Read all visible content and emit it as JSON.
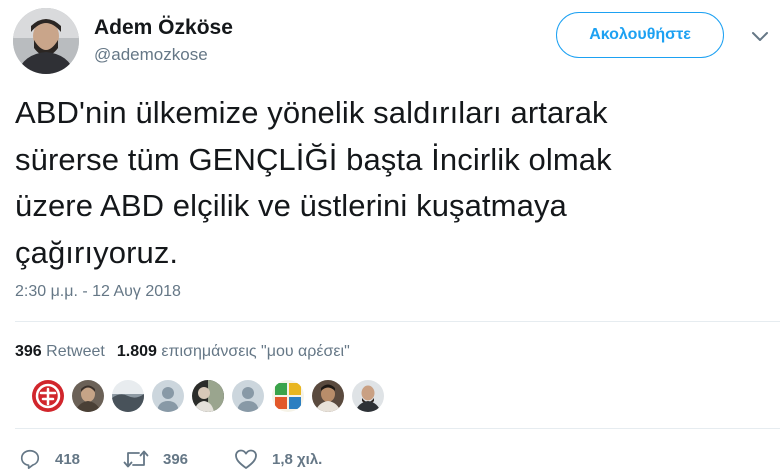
{
  "user": {
    "name": "Adem Özköse",
    "handle": "@ademozkose",
    "follow_label": "Ακολουθήστε"
  },
  "tweet": {
    "lines": [
      "ABD'nin ülkemize yönelik saldırıları artarak",
      "sürerse tüm GENÇLİĞİ başta İncirlik olmak",
      "üzere ABD elçilik ve üstlerini kuşatmaya",
      "çağırıyoruz."
    ],
    "timestamp": "2:30 μ.μ. - 12 Αυγ 2018"
  },
  "stats": {
    "retweets_count": "396",
    "retweets_label": "Retweet",
    "likes_count": "1.809",
    "likes_label": "επισημάνσεις \"μου αρέσει\""
  },
  "likers": [
    {
      "icon": "red-logo-avatar"
    },
    {
      "icon": "person-photo-avatar"
    },
    {
      "icon": "landscape-photo-avatar"
    },
    {
      "icon": "default-avatar"
    },
    {
      "icon": "dark-photo-avatar"
    },
    {
      "icon": "default-avatar"
    },
    {
      "icon": "quba-logo-avatar"
    },
    {
      "icon": "person-photo-avatar"
    },
    {
      "icon": "person-photo-avatar"
    }
  ],
  "actions": {
    "replies": "418",
    "retweets": "396",
    "likes": "1,8 χιλ."
  },
  "colors": {
    "accent": "#1da1f2",
    "secondary_text": "#657786",
    "primary_text": "#14171a",
    "divider": "#e6ecf0"
  }
}
